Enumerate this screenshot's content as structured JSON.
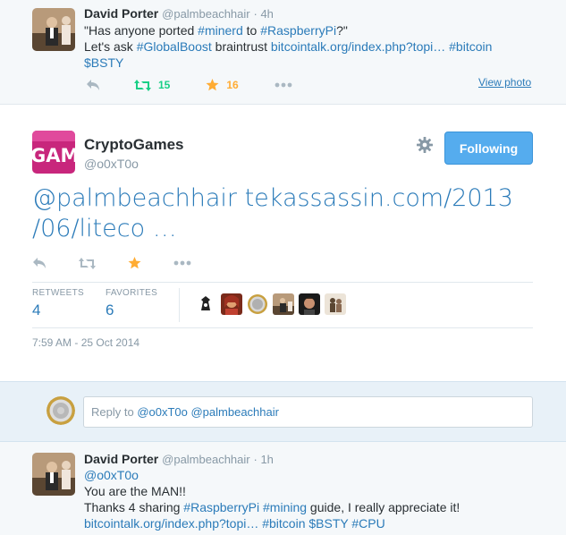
{
  "tweet1": {
    "name": "David Porter",
    "handle": "@palmbeachhair",
    "time": "· 4h",
    "line1": [
      {
        "t": "\"Has anyone ported ",
        "link": false
      },
      {
        "t": "#minerd",
        "link": true
      },
      {
        "t": " to ",
        "link": false
      },
      {
        "t": "#RaspberryPi",
        "link": true
      },
      {
        "t": "?\"",
        "link": false
      }
    ],
    "line2": [
      {
        "t": "Let's ask ",
        "link": false
      },
      {
        "t": "#GlobalBoost",
        "link": true
      },
      {
        "t": " braintrust ",
        "link": false
      },
      {
        "t": "bitcointalk.org/index.php?topi…",
        "link": true
      },
      {
        "t": " ",
        "link": false
      },
      {
        "t": "#bitcoin",
        "link": true
      }
    ],
    "line3": [
      {
        "t": "$BSTY",
        "link": true
      }
    ],
    "retweets": "15",
    "favorites": "16",
    "view_photo": "View photo"
  },
  "tweet2": {
    "name": "CryptoGames",
    "handle": "@o0xT0o",
    "follow_label": "Following",
    "text_line1": "@palmbeachhair tekassassin.com/2013",
    "text_line2": "/06/liteco …",
    "stats": {
      "retweets_label": "RETWEETS",
      "retweets_value": "4",
      "favorites_label": "FAVORITES",
      "favorites_value": "6"
    },
    "timestamp": "7:59 AM - 25 Oct 2014"
  },
  "reply": {
    "placeholder": "Reply to ",
    "handles": "@o0xT0o @palmbeachhair"
  },
  "tweet3": {
    "name": "David Porter",
    "handle": "@palmbeachhair",
    "time": "· 1h",
    "line1": [
      {
        "t": "@o0xT0o",
        "link": true
      }
    ],
    "line2": [
      {
        "t": "You are the MAN!!",
        "link": false
      }
    ],
    "line3": [
      {
        "t": "Thanks 4 sharing ",
        "link": false
      },
      {
        "t": "#RaspberryPi",
        "link": true
      },
      {
        "t": " ",
        "link": false
      },
      {
        "t": "#mining",
        "link": true
      },
      {
        "t": " guide, I really appreciate it!",
        "link": false
      }
    ],
    "line4": [
      {
        "t": "bitcointalk.org/index.php?topi…",
        "link": true
      },
      {
        "t": " ",
        "link": false
      },
      {
        "t": "#bitcoin",
        "link": true
      },
      {
        "t": " ",
        "link": false
      },
      {
        "t": "$BSTY",
        "link": true
      },
      {
        "t": " ",
        "link": false
      },
      {
        "t": "#CPU",
        "link": true
      }
    ]
  },
  "colors": {
    "link": "#2b7bb9",
    "retweet": "#19cf86",
    "favorite": "#ffac33",
    "button": "#55acee"
  },
  "icons": [
    "reply-icon",
    "retweet-icon",
    "favorite-icon",
    "more-icon",
    "gear-icon"
  ]
}
